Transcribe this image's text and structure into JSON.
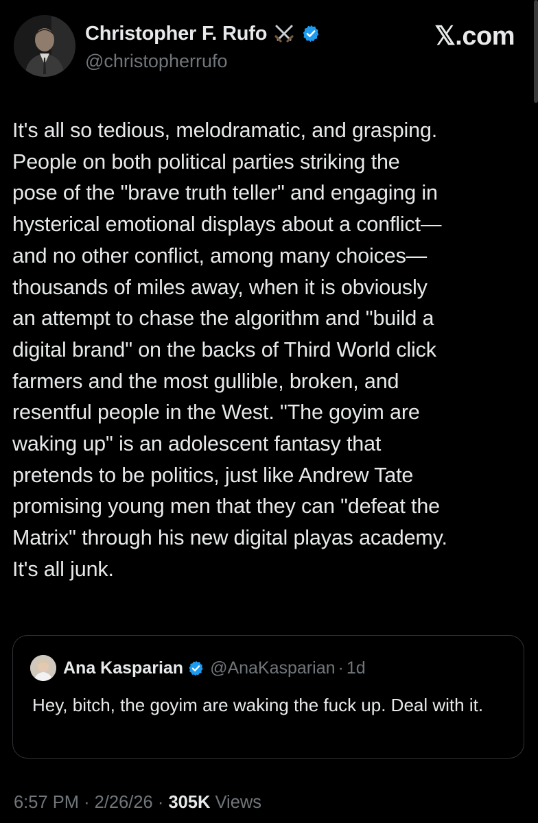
{
  "author": {
    "display_name": "Christopher F. Rufo",
    "handle": "@christopherrufo",
    "badge_icon": "crossed-swords-icon",
    "verified_icon": "verified-badge-icon",
    "verified_color": "#1d9bf0"
  },
  "brand": {
    "label": "𝕏.com"
  },
  "tweet": {
    "text": "It's all so tedious, melodramatic, and grasping.\nPeople on both political parties striking the\npose of the \"brave truth teller\" and engaging in\nhysterical emotional displays about a conflict—\nand no other conflict, among many choices—\nthousands of miles away, when it is obviously\nan attempt to chase the algorithm and \"build a\ndigital brand\" on the backs of Third World click\nfarmers and the most gullible, broken, and\nresentful people in the West. \"The goyim are\nwaking up\" is an adolescent fantasy that\npretends to be politics, just like Andrew Tate\npromising young men that they can \"defeat the\nMatrix\" through his new digital playas academy.\nIt's all junk."
  },
  "quoted_tweet": {
    "display_name": "Ana Kasparian",
    "handle": "@AnaKasparian",
    "separator": "·",
    "time": "1d",
    "text": "Hey, bitch, the goyim are waking the fuck up. Deal with it."
  },
  "meta": {
    "time": "6:57 PM",
    "separator": "·",
    "date": "2/26/26",
    "views_count": "305K",
    "views_label": "Views"
  },
  "colors": {
    "background": "#000000",
    "text": "#e7e9ea",
    "muted": "#71767b",
    "border": "#2f3336"
  }
}
